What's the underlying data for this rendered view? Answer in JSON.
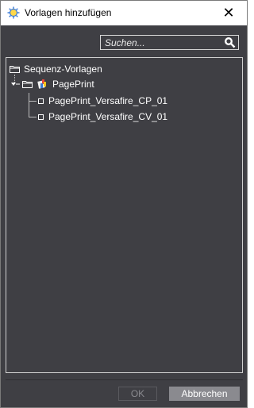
{
  "window": {
    "title": "Vorlagen hinzufügen",
    "close_label": "✕"
  },
  "search": {
    "placeholder": "Suchen..."
  },
  "tree": {
    "root_label": "Sequenz-Vorlagen",
    "group_label": "PagePrint",
    "items": [
      {
        "label": "PagePrint_Versafire_CP_01"
      },
      {
        "label": "PagePrint_Versafire_CV_01"
      }
    ]
  },
  "buttons": {
    "ok_label": "OK",
    "cancel_label": "Abbrechen"
  },
  "colors": {
    "panel_bg": "#3f3f44",
    "cancel_bg": "#8a8a8f",
    "text": "#ffffff"
  }
}
